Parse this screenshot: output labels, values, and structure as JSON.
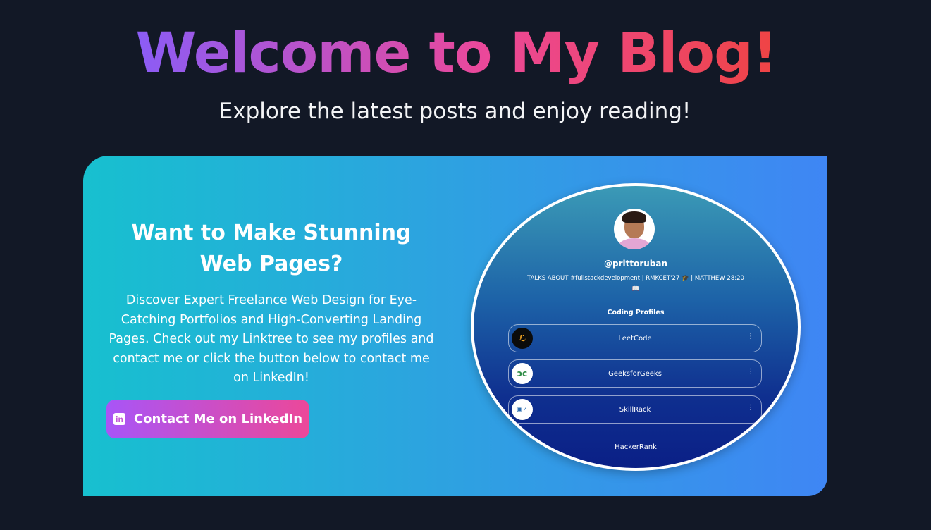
{
  "hero": {
    "title": "Welcome to My Blog!",
    "subtitle": "Explore the latest posts and enjoy reading!"
  },
  "promo": {
    "title": "Want to Make Stunning Web Pages?",
    "description": "Discover Expert Freelance Web Design for Eye-Catching Portfolios and High-Converting Landing Pages. Check out my Linktree to see my profiles and contact me or click the button below to contact me on LinkedIn!",
    "button_label": "Contact Me on LinkedIn",
    "button_icon": "linkedin-icon"
  },
  "linktree_preview": {
    "handle": "@prittoruban",
    "bio": "TALKS ABOUT #fullstackdevelopment | RMKCET'27 🎓 | MATTHEW 28:20 📖",
    "section_heading": "Coding Profiles",
    "links": [
      {
        "label": "LeetCode",
        "icon": "leetcode-icon"
      },
      {
        "label": "GeeksforGeeks",
        "icon": "geeksforgeeks-icon"
      },
      {
        "label": "SkillRack",
        "icon": "skillrack-icon"
      },
      {
        "label": "HackerRank",
        "icon": ""
      }
    ]
  },
  "colors": {
    "background": "#121826",
    "title_gradient": [
      "#8b5cf6",
      "#ec4899",
      "#ef4444"
    ],
    "card_gradient": [
      "#17c0cf",
      "#3f86f4"
    ],
    "button_gradient": [
      "#a855f7",
      "#ec4899"
    ]
  }
}
